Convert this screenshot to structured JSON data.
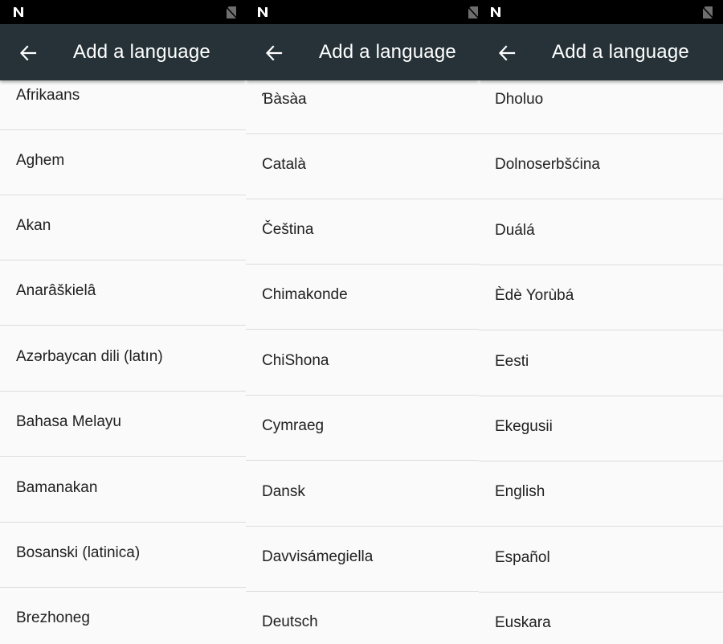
{
  "panels": [
    {
      "title": "Add a language",
      "languages": [
        "Afrikaans",
        "Aghem",
        "Akan",
        "Anarâškielâ",
        "Azərbaycan dili (latın)",
        "Bahasa Melayu",
        "Bamanakan",
        "Bosanski (latinica)",
        "Brezhoneg"
      ]
    },
    {
      "title": "Add a language",
      "languages": [
        "Ɓàsàa",
        "Català",
        "Čeština",
        "Chimakonde",
        "ChiShona",
        "Cymraeg",
        "Dansk",
        "Davvisámegiella",
        "Deutsch"
      ]
    },
    {
      "title": "Add a language",
      "languages": [
        "Dholuo",
        "Dolnoserbšćina",
        "Duálá",
        "Èdè Yorùbá",
        "Eesti",
        "Ekegusii",
        "English",
        "Español",
        "Euskara"
      ]
    }
  ],
  "colors": {
    "status_bar": "#000000",
    "app_bar": "#263238",
    "list_background": "#fafafa",
    "divider": "#dcdcdc",
    "text": "#212121"
  },
  "icons": {
    "status_left": "notification-n-icon",
    "status_right": "no-sim-icon",
    "navigation": "back-arrow-icon"
  }
}
